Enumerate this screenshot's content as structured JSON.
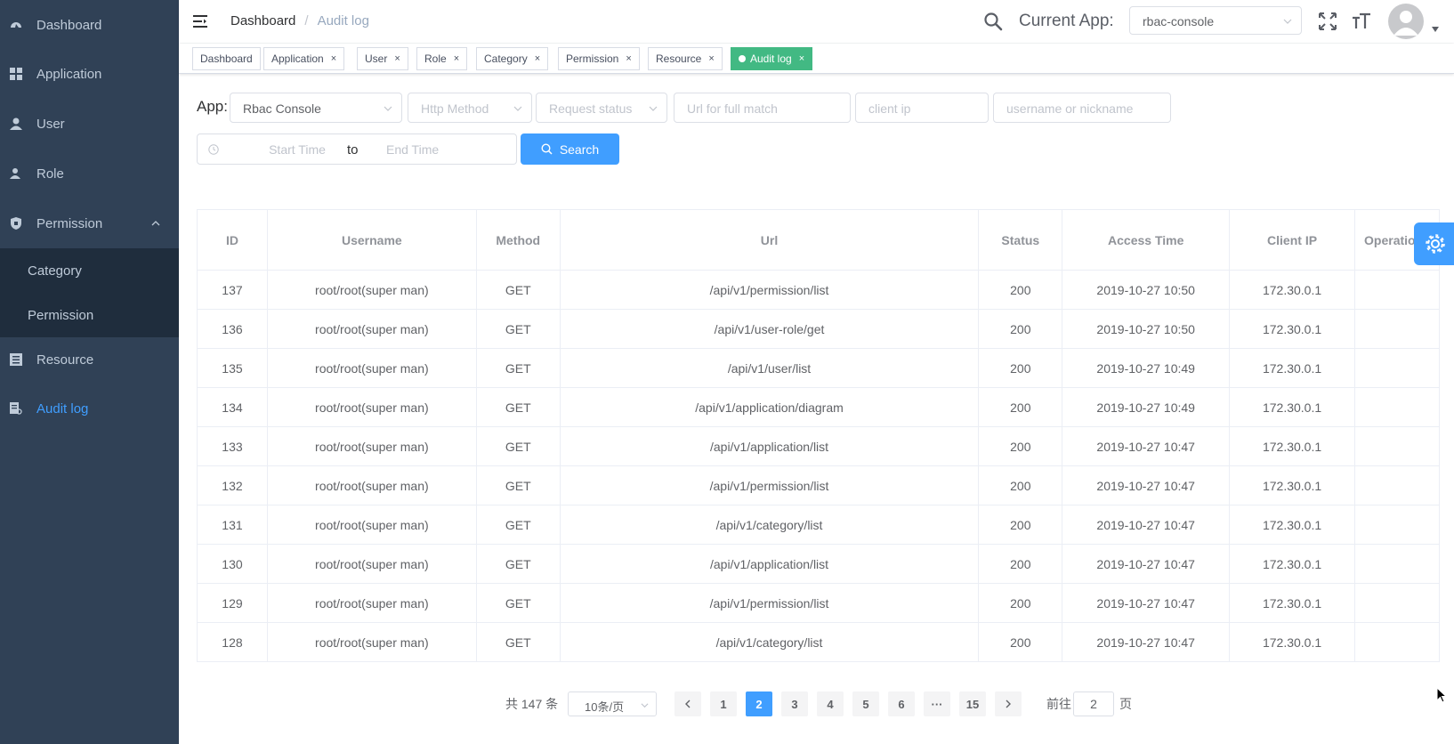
{
  "sidebar": {
    "items": [
      {
        "label": "Dashboard",
        "icon": "dashboard-icon"
      },
      {
        "label": "Application",
        "icon": "grid-icon"
      },
      {
        "label": "User",
        "icon": "user-icon"
      },
      {
        "label": "Role",
        "icon": "role-icon"
      },
      {
        "label": "Permission",
        "icon": "shield-icon"
      },
      {
        "label": "Resource",
        "icon": "list-icon"
      },
      {
        "label": "Audit log",
        "icon": "audit-icon"
      }
    ],
    "submenu": [
      "Category",
      "Permission"
    ],
    "active": "Audit log",
    "bg": "#304156",
    "active_color": "#409eff"
  },
  "header": {
    "breadcrumb": [
      "Dashboard",
      "Audit log"
    ],
    "breadcrumb_sep": "/",
    "current_app_label": "Current App:",
    "current_app_value": "rbac-console"
  },
  "tags": [
    {
      "label": "Dashboard"
    },
    {
      "label": "Application"
    },
    {
      "label": "User"
    },
    {
      "label": "Role"
    },
    {
      "label": "Category"
    },
    {
      "label": "Permission"
    },
    {
      "label": "Resource"
    },
    {
      "label": "Audit log",
      "active": true
    }
  ],
  "filters": {
    "app_label": "App:",
    "app_value": "Rbac Console",
    "http_method_placeholder": "Http Method",
    "request_status_placeholder": "Request status",
    "url_placeholder": "Url for full match",
    "client_ip_placeholder": "client ip",
    "username_placeholder": "username or nickname",
    "start_placeholder": "Start Time",
    "range_sep": "to",
    "end_placeholder": "End Time",
    "search_label": "Search"
  },
  "table": {
    "columns": [
      "ID",
      "Username",
      "Method",
      "Url",
      "Status",
      "Access Time",
      "Client IP",
      "Operations"
    ],
    "rows": [
      [
        "137",
        "root/root(super man)",
        "GET",
        "/api/v1/permission/list",
        "200",
        "2019-10-27 10:50",
        "172.30.0.1"
      ],
      [
        "136",
        "root/root(super man)",
        "GET",
        "/api/v1/user-role/get",
        "200",
        "2019-10-27 10:50",
        "172.30.0.1"
      ],
      [
        "135",
        "root/root(super man)",
        "GET",
        "/api/v1/user/list",
        "200",
        "2019-10-27 10:49",
        "172.30.0.1"
      ],
      [
        "134",
        "root/root(super man)",
        "GET",
        "/api/v1/application/diagram",
        "200",
        "2019-10-27 10:49",
        "172.30.0.1"
      ],
      [
        "133",
        "root/root(super man)",
        "GET",
        "/api/v1/application/list",
        "200",
        "2019-10-27 10:47",
        "172.30.0.1"
      ],
      [
        "132",
        "root/root(super man)",
        "GET",
        "/api/v1/permission/list",
        "200",
        "2019-10-27 10:47",
        "172.30.0.1"
      ],
      [
        "131",
        "root/root(super man)",
        "GET",
        "/api/v1/category/list",
        "200",
        "2019-10-27 10:47",
        "172.30.0.1"
      ],
      [
        "130",
        "root/root(super man)",
        "GET",
        "/api/v1/application/list",
        "200",
        "2019-10-27 10:47",
        "172.30.0.1"
      ],
      [
        "129",
        "root/root(super man)",
        "GET",
        "/api/v1/permission/list",
        "200",
        "2019-10-27 10:47",
        "172.30.0.1"
      ],
      [
        "128",
        "root/root(super man)",
        "GET",
        "/api/v1/category/list",
        "200",
        "2019-10-27 10:47",
        "172.30.0.1"
      ]
    ]
  },
  "pagination": {
    "total_text": "共 147 条",
    "page_size": "10条/页",
    "pages": [
      "1",
      "2",
      "3",
      "4",
      "5",
      "6",
      "···",
      "15"
    ],
    "current": "2",
    "goto_label": "前往",
    "goto_value": "2",
    "page_suffix": "页"
  }
}
